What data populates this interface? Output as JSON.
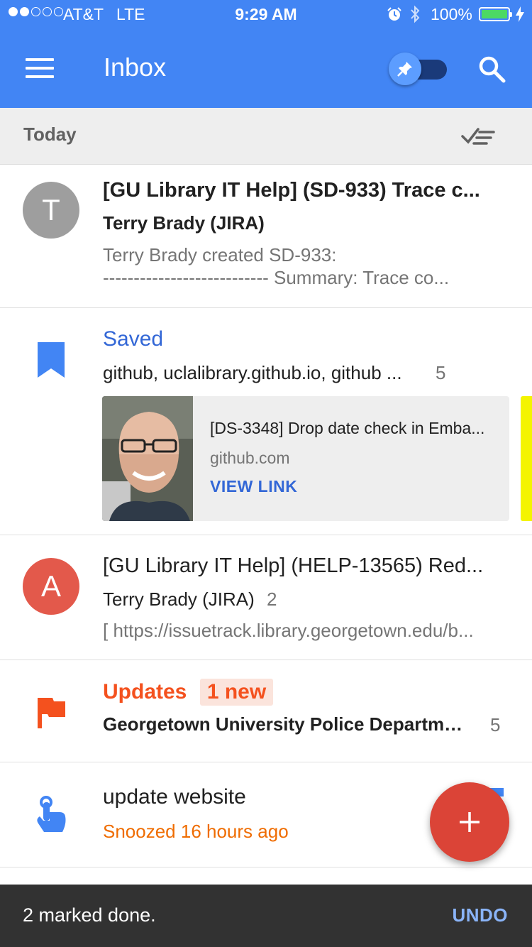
{
  "status_bar": {
    "carrier": "AT&T",
    "network": "LTE",
    "time": "9:29 AM",
    "battery_percent": "100%",
    "signal_bars": 2,
    "signal_total": 5,
    "battery_color": "#4cd964"
  },
  "app_bar": {
    "title": "Inbox",
    "color": "#4285f4",
    "pinned_toggle_on": true
  },
  "section": {
    "label": "Today"
  },
  "items": [
    {
      "avatar_letter": "T",
      "avatar_color": "#9e9e9e",
      "subject": "[GU Library IT Help]  (SD-933) Trace c...",
      "sender": "Terry Brady (JIRA)",
      "snippet_line1": "Terry Brady created SD-933:",
      "snippet_line2": "--------------------------- Summary: Trace co..."
    },
    {
      "icon": "bookmark-icon",
      "label": "Saved",
      "senders": "github, uclalibrary.github.io, github ...",
      "count": "5",
      "card": {
        "title": "[DS-3348] Drop date check in Emba...",
        "domain": "github.com",
        "link_label": "VIEW LINK"
      }
    },
    {
      "avatar_letter": "A",
      "avatar_color": "#e3594b",
      "subject": "[GU Library IT Help]  (HELP-13565) Red...",
      "sender": "Terry Brady (JIRA)",
      "count": "2",
      "snippet": "[ https://issuetrack.library.georgetown.edu/b..."
    },
    {
      "icon": "flag-icon",
      "label": "Updates",
      "badge": "1 new",
      "sender": "Georgetown University Police Departme ...",
      "count": "5"
    },
    {
      "icon": "reminder-hand-icon",
      "title": "update website",
      "status": "Snoozed 16 hours ago"
    }
  ],
  "fab": {
    "icon": "plus-icon",
    "color": "#db4437"
  },
  "snackbar": {
    "message": "2 marked done.",
    "action": "UNDO"
  }
}
